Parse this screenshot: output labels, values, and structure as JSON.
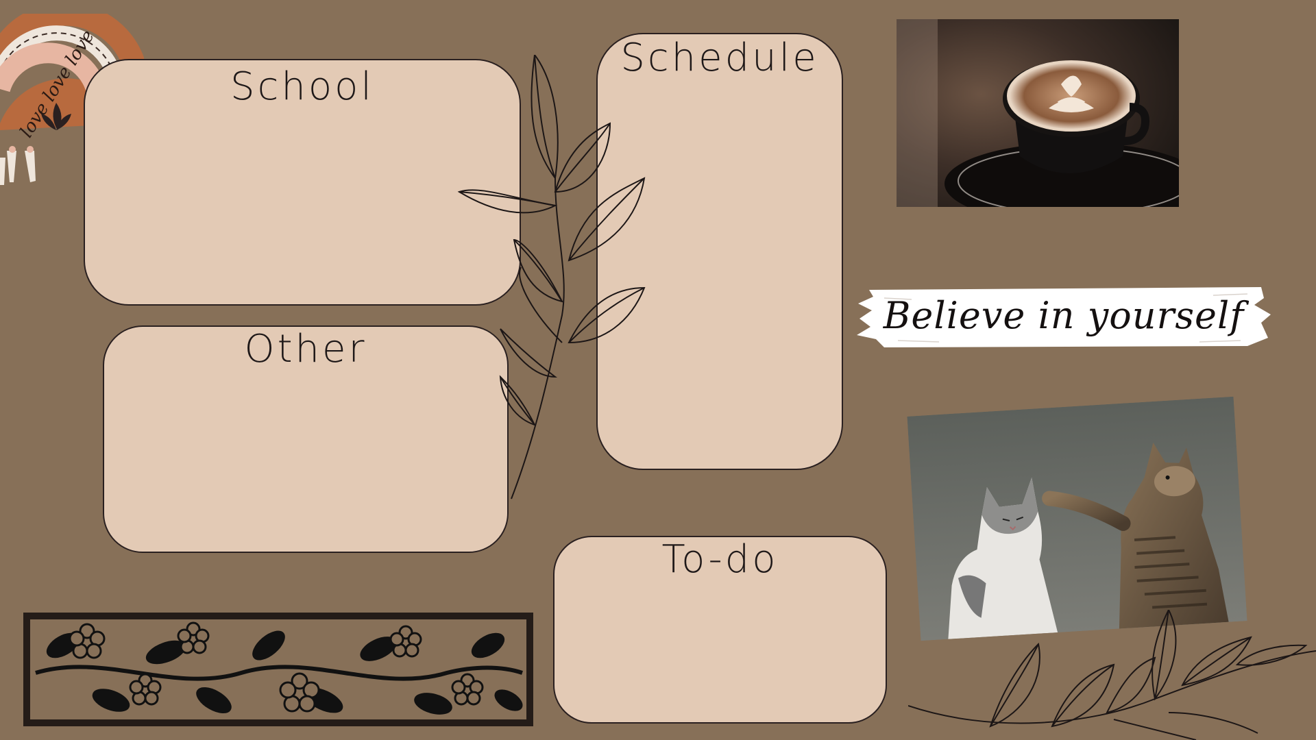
{
  "board": {
    "cards": {
      "school": "School",
      "other": "Other",
      "schedule": "Schedule",
      "todo": "To-do"
    },
    "quote": "Believe in yourself",
    "rainbow_text": "love love love"
  },
  "colors": {
    "background": "#877058",
    "card_fill": "#e3cab5",
    "card_border": "#2a2020",
    "ink": "#1e1818"
  },
  "decor": {
    "rainbow_sticker": "rainbow-sticker-icon",
    "leaf_branch": "leaf-branch-icon",
    "floral_border": "floral-border-icon"
  }
}
